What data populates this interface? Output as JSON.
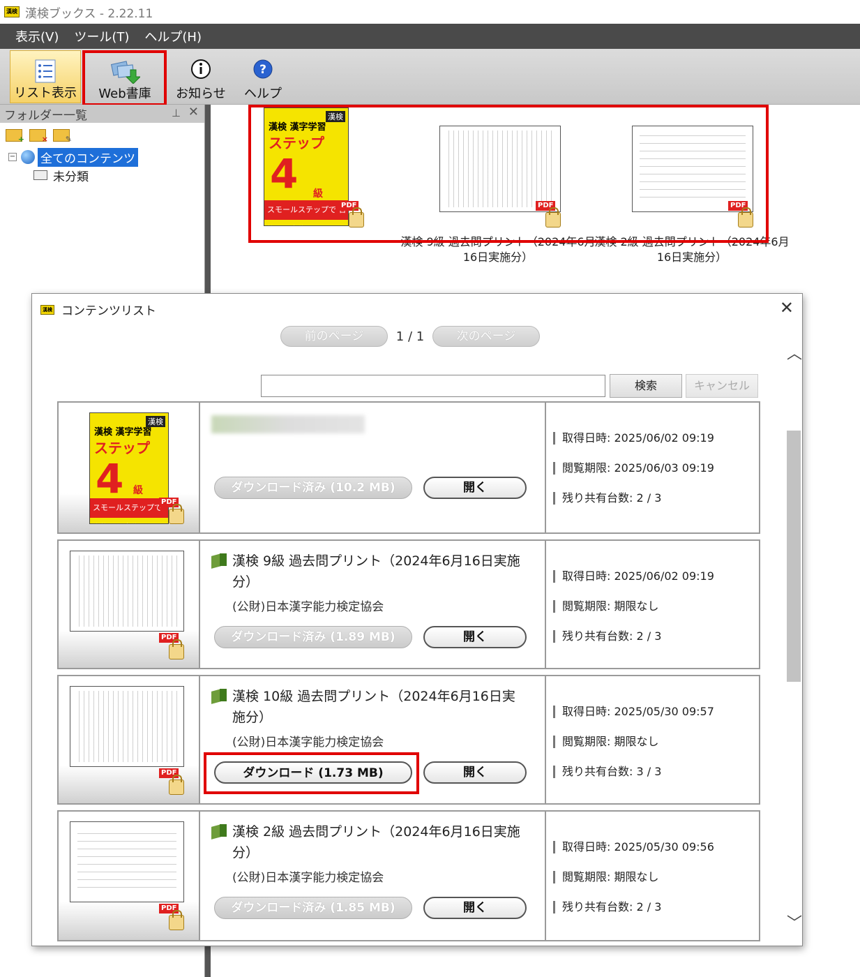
{
  "app": {
    "title": "漢検ブックス - 2.22.11",
    "icon_text": "漢検"
  },
  "menu": {
    "items": [
      "表示(V)",
      "ツール(T)",
      "ヘルプ(H)"
    ]
  },
  "toolbar": {
    "list_label": "リスト表示",
    "web_label": "Web書庫",
    "news_label": "お知らせ",
    "help_label": "ヘルプ"
  },
  "folder_panel": {
    "title": "フォルダー一覧",
    "pin": "ㅁ",
    "close": "✕",
    "all_contents": "全てのコンテンツ",
    "uncategorized": "未分類"
  },
  "shelf": {
    "books": [
      {
        "caption": "",
        "cover_title": "漢検 漢字学習",
        "cover_sub": "ステップ",
        "cover_num": "4",
        "cover_kyu": "級",
        "cover_band": "スモールステップで 合格への自信。",
        "cover_tag": "漢検"
      },
      {
        "caption": "漢検 9級 過去問プリント（2024年6月16日実施分）"
      },
      {
        "caption": "漢検 2級 過去問プリント（2024年6月16日実施分）"
      }
    ]
  },
  "dialog": {
    "title": "コンテンツリスト",
    "close": "✕",
    "prev_page": "前のページ",
    "page_indicator": "1 / 1",
    "next_page": "次のページ",
    "search_value": "",
    "search_button": "検索",
    "cancel_button": "キャンセル",
    "scroll_up": "︿",
    "scroll_down": "﹀",
    "items": [
      {
        "title": "",
        "publisher": "",
        "download_label": "ダウンロード済み (10.2 MB)",
        "open_label": "開く",
        "acquired": "取得日時: 2025/06/02 09:19",
        "expiry": "閲覧期限: 2025/06/03 09:19",
        "shares": "残り共有台数: 2 / 3"
      },
      {
        "title": "漢検 9級 過去問プリント（2024年6月16日実施分）",
        "publisher": "(公財)日本漢字能力検定協会",
        "download_label": "ダウンロード済み (1.89 MB)",
        "open_label": "開く",
        "acquired": "取得日時: 2025/06/02 09:19",
        "expiry": "閲覧期限: 期限なし",
        "shares": "残り共有台数: 2 / 3"
      },
      {
        "title": "漢検 10級 過去問プリント（2024年6月16日実施分）",
        "publisher": "(公財)日本漢字能力検定協会",
        "download_label": "ダウンロード (1.73 MB)",
        "open_label": "開く",
        "acquired": "取得日時: 2025/05/30 09:57",
        "expiry": "閲覧期限: 期限なし",
        "shares": "残り共有台数: 3 / 3"
      },
      {
        "title": "漢検 2級 過去問プリント（2024年6月16日実施分）",
        "publisher": "(公財)日本漢字能力検定協会",
        "download_label": "ダウンロード済み (1.85 MB)",
        "open_label": "開く",
        "acquired": "取得日時: 2025/05/30 09:56",
        "expiry": "閲覧期限: 期限なし",
        "shares": "残り共有台数: 2 / 3"
      }
    ]
  },
  "colors": {
    "highlight": "#e00000",
    "menubar": "#4a4a4a",
    "selection": "#1e6fd9",
    "cover_yellow": "#f5e400"
  },
  "pdf_label": "PDF"
}
